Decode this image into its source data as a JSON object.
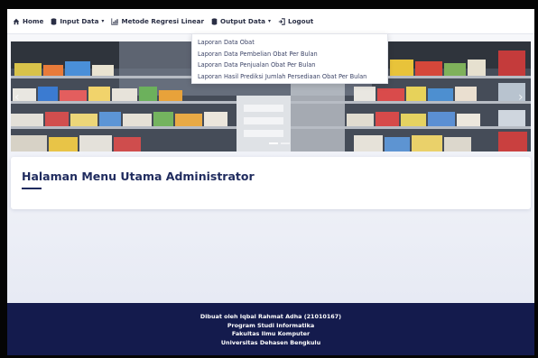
{
  "nav": {
    "home_label": "Home",
    "input_label": "Input Data",
    "metode_label": "Metode Regresi Linear",
    "output_label": "Output Data",
    "logout_label": "Logout"
  },
  "dropdown": {
    "items": [
      "Laporan Data Obat",
      "Laporan Data Pembelian Obat Per Bulan",
      "Laporan Data Penjualan Obat Per Bulan",
      "Laporan Hasil Prediksi Jumlah Persediaan Obat Per Bulan"
    ]
  },
  "hero": {
    "prev_glyph": "‹",
    "next_glyph": "›"
  },
  "page": {
    "title": "Halaman Menu Utama Administrator"
  },
  "footer": {
    "line1": "Dibuat oleh Iqbal Rahmat Adha (21010167)",
    "line2": "Program Studi Informatika",
    "line3": "Fakultas Ilmu Komputer",
    "line4": "Universitas Dehasen Bengkulu"
  },
  "colors": {
    "navy": "#141b4d",
    "title": "#1f2b5e"
  }
}
